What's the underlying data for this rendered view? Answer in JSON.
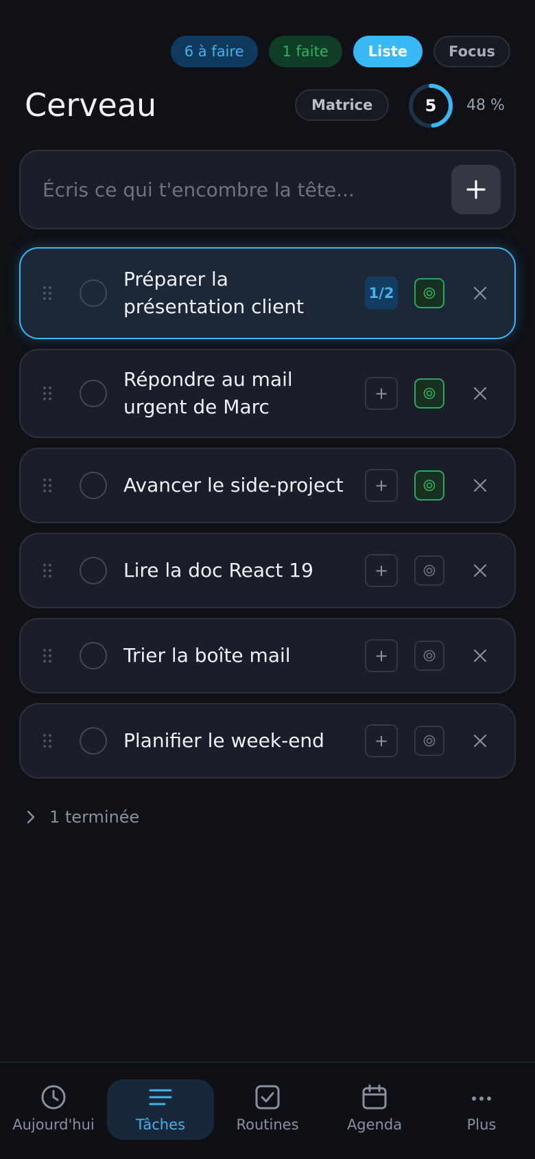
{
  "filters": {
    "todo": "6 à faire",
    "done": "1 faite",
    "list": "Liste",
    "focus": "Focus"
  },
  "header": {
    "title": "Cerveau",
    "matrix": "Matrice",
    "ring_value": "5",
    "ring_progress": 0.48,
    "percent": "48 %"
  },
  "input": {
    "placeholder": "Écris ce qui t'encombre la tête..."
  },
  "tasks": [
    {
      "text": "Préparer la présentation client",
      "subtasks": "1/2",
      "focus": true,
      "active": true
    },
    {
      "text": "Répondre au mail urgent de Marc",
      "subtasks": "+",
      "focus": true,
      "active": false
    },
    {
      "text": "Avancer le side-project",
      "subtasks": "+",
      "focus": true,
      "active": false
    },
    {
      "text": "Lire la doc React 19",
      "subtasks": "+",
      "focus": false,
      "active": false
    },
    {
      "text": "Trier la boîte mail",
      "subtasks": "+",
      "focus": false,
      "active": false
    },
    {
      "text": "Planifier le week-end",
      "subtasks": "+",
      "focus": false,
      "active": false
    }
  ],
  "completed_toggle": "1 terminée",
  "nav": [
    {
      "label": "Aujourd'hui",
      "icon": "clock-icon"
    },
    {
      "label": "Tâches",
      "icon": "list-icon"
    },
    {
      "label": "Routines",
      "icon": "checkbox-icon"
    },
    {
      "label": "Agenda",
      "icon": "calendar-icon"
    },
    {
      "label": "Plus",
      "icon": "more-icon"
    }
  ],
  "colors": {
    "accent": "#38b8f5",
    "focus_green": "#2ea75a",
    "background": "#0f1117",
    "card": "#1b1e2a"
  }
}
